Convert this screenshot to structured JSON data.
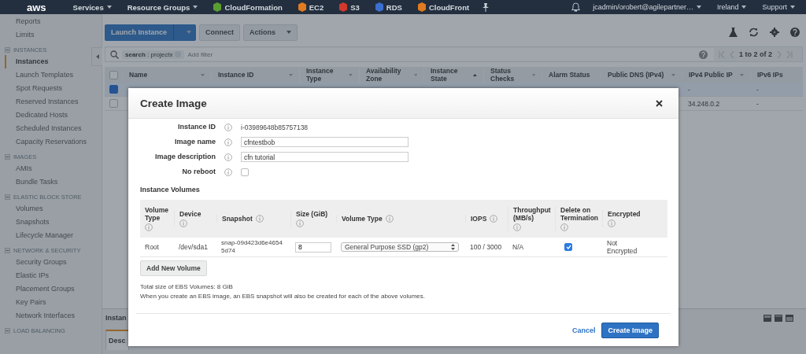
{
  "top_nav": {
    "logo": "aws",
    "menus": [
      {
        "label": "Services"
      },
      {
        "label": "Resource Groups"
      }
    ],
    "shortcuts": [
      {
        "label": "CloudFormation",
        "color": "#5a9e2f"
      },
      {
        "label": "EC2",
        "color": "#e07b22"
      },
      {
        "label": "S3",
        "color": "#d0392b"
      },
      {
        "label": "RDS",
        "color": "#3b6fd0"
      },
      {
        "label": "CloudFront",
        "color": "#e07b22"
      }
    ],
    "account": "jcadmin/orobert@agilepartner…",
    "region": "Ireland",
    "support": "Support"
  },
  "sidebar": {
    "items": [
      {
        "kind": "link",
        "label": "Reports",
        "selected": false
      },
      {
        "kind": "link",
        "label": "Limits",
        "selected": false
      },
      {
        "kind": "section",
        "label": "INSTANCES",
        "expanded": true
      },
      {
        "kind": "link",
        "label": "Instances",
        "selected": true
      },
      {
        "kind": "link",
        "label": "Launch Templates",
        "selected": false
      },
      {
        "kind": "link",
        "label": "Spot Requests",
        "selected": false
      },
      {
        "kind": "link",
        "label": "Reserved Instances",
        "selected": false
      },
      {
        "kind": "link",
        "label": "Dedicated Hosts",
        "selected": false
      },
      {
        "kind": "link",
        "label": "Scheduled Instances",
        "selected": false
      },
      {
        "kind": "link",
        "label": "Capacity Reservations",
        "selected": false
      },
      {
        "kind": "section",
        "label": "IMAGES",
        "expanded": true
      },
      {
        "kind": "link",
        "label": "AMIs",
        "selected": false
      },
      {
        "kind": "link",
        "label": "Bundle Tasks",
        "selected": false
      },
      {
        "kind": "section",
        "label": "ELASTIC BLOCK STORE",
        "expanded": true
      },
      {
        "kind": "link",
        "label": "Volumes",
        "selected": false
      },
      {
        "kind": "link",
        "label": "Snapshots",
        "selected": false
      },
      {
        "kind": "link",
        "label": "Lifecycle Manager",
        "selected": false
      },
      {
        "kind": "section",
        "label": "NETWORK & SECURITY",
        "expanded": true
      },
      {
        "kind": "link",
        "label": "Security Groups",
        "selected": false
      },
      {
        "kind": "link",
        "label": "Elastic IPs",
        "selected": false
      },
      {
        "kind": "link",
        "label": "Placement Groups",
        "selected": false
      },
      {
        "kind": "link",
        "label": "Key Pairs",
        "selected": false
      },
      {
        "kind": "link",
        "label": "Network Interfaces",
        "selected": false
      },
      {
        "kind": "section",
        "label": "LOAD BALANCING",
        "expanded": true
      }
    ]
  },
  "toolbar": {
    "primary": "Launch Instance",
    "buttons": [
      {
        "label": "Connect",
        "dropdown": false
      },
      {
        "label": "Actions",
        "dropdown": true
      }
    ]
  },
  "filter": {
    "token": "**search** : projectx",
    "placeholder": "Add filter",
    "pagination": "1 to 2 of 2"
  },
  "table": {
    "all_selected": false,
    "columns": [
      {
        "label": "Name",
        "sortable": true,
        "sorted": false
      },
      {
        "label": "Instance ID",
        "sortable": true,
        "sorted": false
      },
      {
        "label": "Instance Type",
        "sortable": true,
        "sorted": false
      },
      {
        "label": "Availability Zone",
        "sortable": true,
        "sorted": false
      },
      {
        "label": "Instance State",
        "sortable": true,
        "sorted": true
      },
      {
        "label": "Status Checks",
        "sortable": true,
        "sorted": false
      },
      {
        "label": "Alarm Status",
        "sortable": false,
        "sorted": false
      },
      {
        "label": "Public DNS (IPv4)",
        "sortable": true,
        "sorted": false
      },
      {
        "label": "IPv4 Public IP",
        "sortable": true,
        "sorted": false
      },
      {
        "label": "IPv6 IPs",
        "sortable": false,
        "sorted": false
      }
    ],
    "rows": [
      {
        "selected": true,
        "ipv4_public_ip": "-",
        "ipv6_ips": "-"
      },
      {
        "selected": false,
        "ipv4_public_ip": "34.248.0.2",
        "ipv6_ips": "-"
      }
    ]
  },
  "bottom_panel": {
    "title": "Instan",
    "tabs": [
      {
        "label": "Desc",
        "selected": true
      }
    ]
  },
  "modal": {
    "title": "Create Image",
    "fields": [
      {
        "kind": "text",
        "label": "Instance ID",
        "value": "i-03989648b85757138"
      },
      {
        "kind": "input",
        "label": "Image name",
        "value": "cfntestbob"
      },
      {
        "kind": "input",
        "label": "Image description",
        "value": "cfn tutorial"
      },
      {
        "kind": "checkbox",
        "label": "No reboot",
        "checked": false
      }
    ],
    "volumes_heading": "Instance Volumes",
    "volume_columns": [
      {
        "label": "Volume Type",
        "info": true
      },
      {
        "label": "Device",
        "info": true
      },
      {
        "label": "Snapshot",
        "info": true
      },
      {
        "label": "Size (GiB)",
        "info": true
      },
      {
        "label": "Volume Type",
        "info": true
      },
      {
        "label": "IOPS",
        "info": true
      },
      {
        "label": "Throughput (MB/s)",
        "info": true
      },
      {
        "label": "Delete on Termination",
        "info": true
      },
      {
        "label": "Encrypted",
        "info": true
      }
    ],
    "volumes": [
      {
        "volume_type": "Root",
        "device": "/dev/sda1",
        "snapshot": "snap-09d423d6e46545d74",
        "size": "8",
        "type": "General Purpose SSD (gp2)",
        "iops": "100 / 3000",
        "throughput": "N/A",
        "delete_on_termination": true,
        "encrypted": "Not Encrypted"
      }
    ],
    "add_button": "Add New Volume",
    "total": "Total size of EBS Volumes: 8 GiB",
    "note": "When you create an EBS image, an EBS snapshot will also be created for each of the above volumes.",
    "cancel": "Cancel",
    "submit": "Create Image"
  }
}
